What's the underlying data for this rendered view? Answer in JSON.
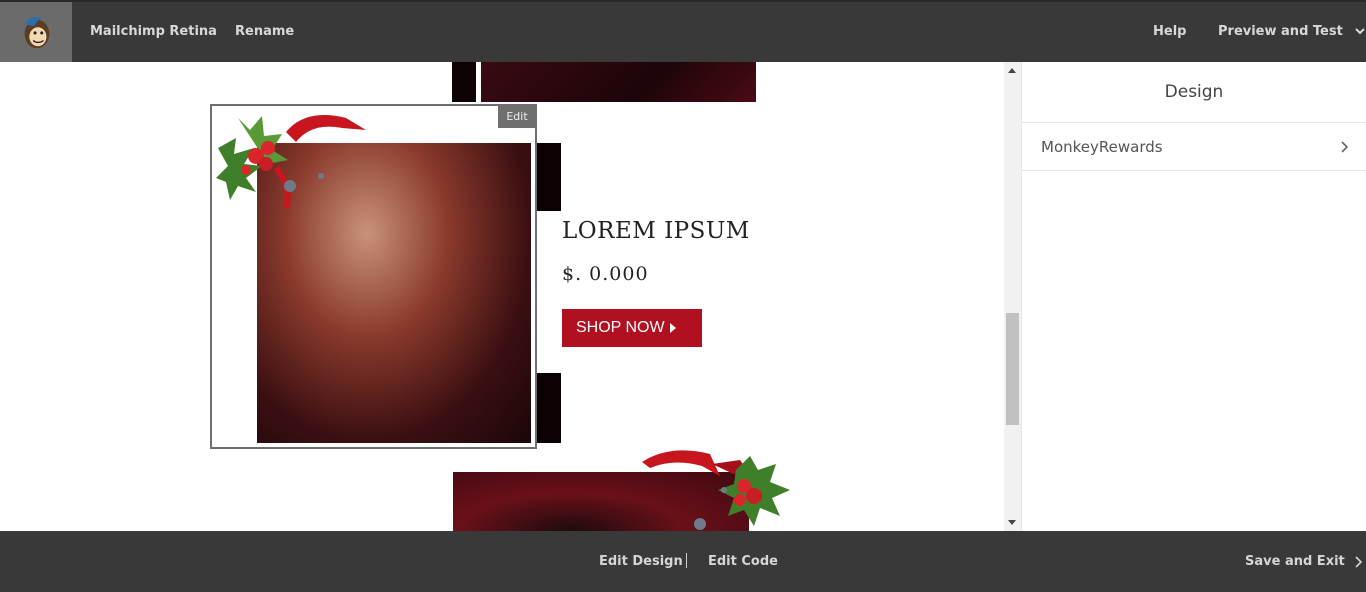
{
  "header": {
    "app_name": "Mailchimp Retina",
    "rename": "Rename",
    "help": "Help",
    "preview_and_test": "Preview and Test"
  },
  "content": {
    "product_title": "LOREM IPSUM",
    "product_price": "$. 0.000",
    "shop_button": "SHOP NOW",
    "edit_tag": "Edit"
  },
  "sidebar": {
    "title": "Design",
    "items": [
      {
        "label": "MonkeyRewards"
      }
    ]
  },
  "footer": {
    "edit_design": "Edit Design",
    "edit_code": "Edit Code",
    "save_and_exit": "Save and Exit"
  },
  "colors": {
    "topbar": "#393939",
    "accent_button": "#b0101f"
  }
}
